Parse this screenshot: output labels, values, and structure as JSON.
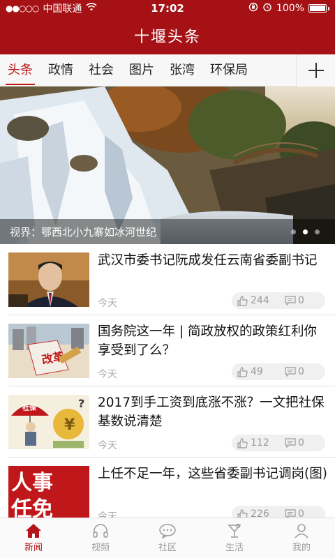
{
  "status_bar": {
    "signal": "●●○○○",
    "carrier": "中国联通",
    "time": "17:02",
    "battery": "100%"
  },
  "app": {
    "title": "十堰头条"
  },
  "tabs": [
    {
      "label": "头条",
      "active": true
    },
    {
      "label": "政情"
    },
    {
      "label": "社会"
    },
    {
      "label": "图片"
    },
    {
      "label": "张湾"
    },
    {
      "label": "环保局"
    }
  ],
  "hero": {
    "caption": "视界：鄂西北小九寨如冰河世纪",
    "page_count": 3,
    "current_page": 2
  },
  "news": [
    {
      "title": "武汉市委书记阮成发任云南省委副书记",
      "time": "今天",
      "likes": "244",
      "comments": "0"
    },
    {
      "title": "国务院这一年 | 简政放权的政策红利你享受到了么？",
      "time": "今天",
      "likes": "49",
      "comments": "0"
    },
    {
      "title": "2017到手工资到底涨不涨？一文把社保基数说清楚",
      "time": "今天",
      "likes": "112",
      "comments": "0"
    },
    {
      "title": "上任不足一年，这些省委副书记调岗(图)",
      "time": "今天",
      "likes": "226",
      "comments": "0"
    }
  ],
  "thumb_text": {
    "reform": "改革",
    "social_security": "社保",
    "personnel_1": "人事",
    "personnel_2": "任免"
  },
  "bottom_nav": [
    {
      "label": "新闻",
      "icon": "home-icon",
      "active": true
    },
    {
      "label": "视频",
      "icon": "headset-icon"
    },
    {
      "label": "社区",
      "icon": "chat-bubble-icon"
    },
    {
      "label": "生活",
      "icon": "cocktail-icon"
    },
    {
      "label": "我的",
      "icon": "person-icon"
    }
  ],
  "colors": {
    "brand_red": "#a51114",
    "accent_red": "#c0171b"
  }
}
